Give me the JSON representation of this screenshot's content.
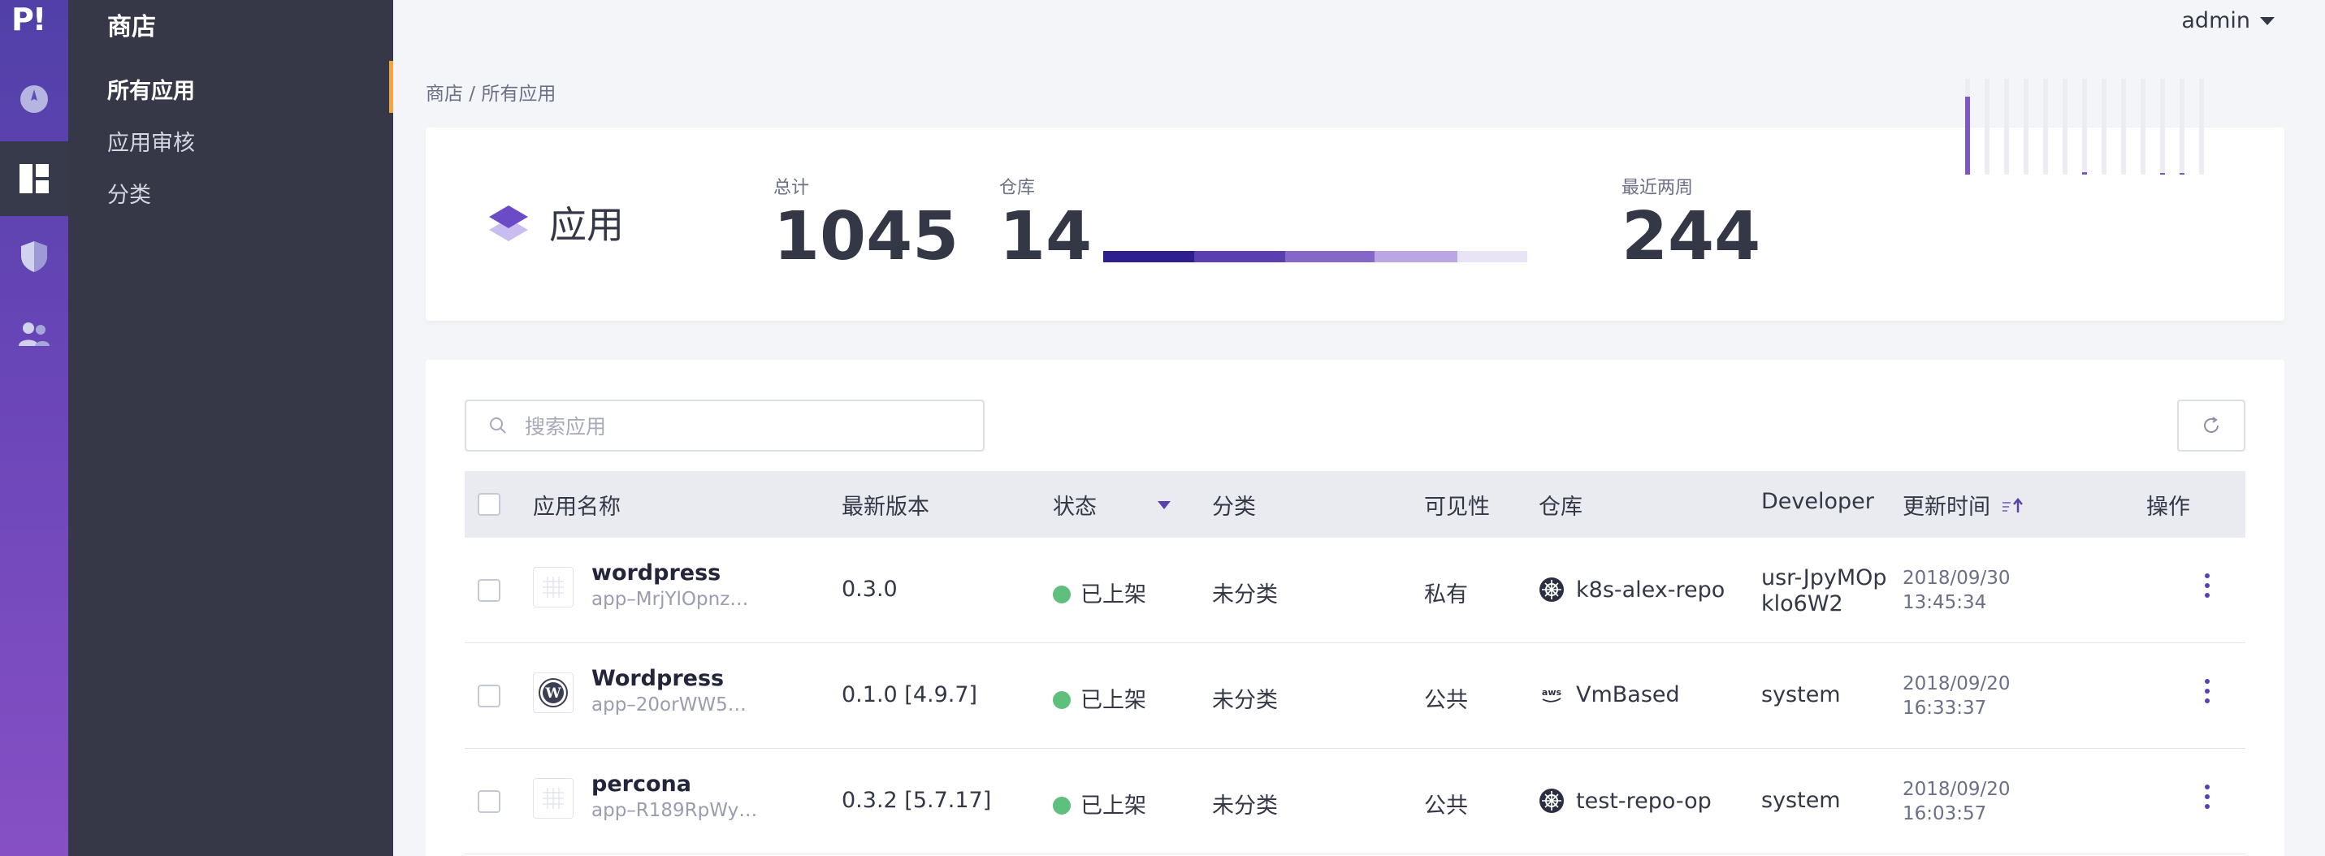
{
  "rail": {
    "logo": "P!"
  },
  "sidebar": {
    "title": "商店",
    "items": [
      {
        "label": "所有应用"
      },
      {
        "label": "应用审核"
      },
      {
        "label": "分类"
      }
    ]
  },
  "header": {
    "user": "admin"
  },
  "breadcrumb": "商店 / 所有应用",
  "stats": {
    "title": "应用",
    "total_label": "总计",
    "total_value": "1045",
    "repo_label": "仓库",
    "repo_value": "14",
    "recent_label": "最近两周",
    "recent_value": "244"
  },
  "search": {
    "placeholder": "搜索应用"
  },
  "table": {
    "headers": {
      "name": "应用名称",
      "version": "最新版本",
      "status": "状态",
      "category": "分类",
      "visibility": "可见性",
      "repo": "仓库",
      "developer": "Developer",
      "updated": "更新时间",
      "actions": "操作"
    },
    "rows": [
      {
        "name": "wordpress",
        "id": "app–MrjYlOpnz…",
        "version": "0.3.0",
        "status": "已上架",
        "category": "未分类",
        "visibility": "私有",
        "repo": "k8s-alex-repo",
        "repo_icon": "helm-wheel-icon",
        "developer_line1": "usr-JpyMOp",
        "developer_line2": "klo6W2",
        "date": "2018/09/30",
        "time": "13:45:34"
      },
      {
        "name": "Wordpress",
        "id": "app–20orWW5…",
        "version": "0.1.0 [4.9.7]",
        "status": "已上架",
        "category": "未分类",
        "visibility": "公共",
        "repo": "VmBased",
        "repo_icon": "aws-icon",
        "developer_line1": "system",
        "developer_line2": "",
        "date": "2018/09/20",
        "time": "16:33:37"
      },
      {
        "name": "percona",
        "id": "app–R189RpWy…",
        "version": "0.3.2 [5.7.17]",
        "status": "已上架",
        "category": "未分类",
        "visibility": "公共",
        "repo": "test-repo-op",
        "repo_icon": "helm-wheel-icon",
        "developer_line1": "system",
        "developer_line2": "",
        "date": "2018/09/20",
        "time": "16:03:57"
      }
    ]
  },
  "colors": {
    "accent": "#5a3fb0",
    "status_green": "#5fbf7c",
    "sidebar_accent": "#f2a641"
  }
}
